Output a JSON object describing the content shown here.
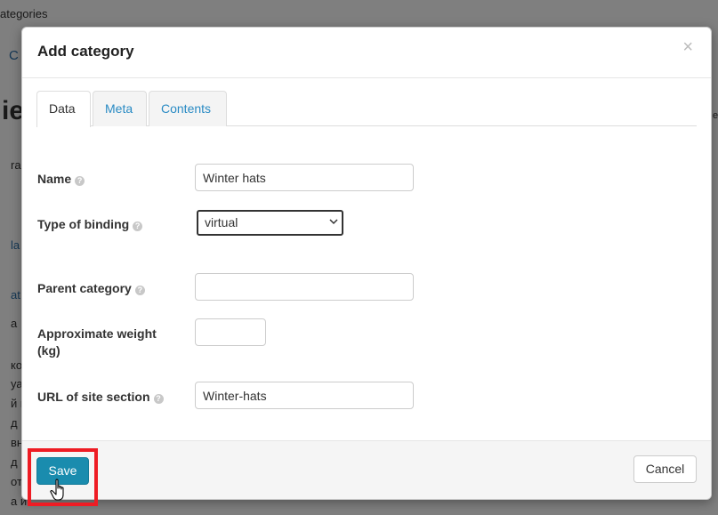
{
  "background": {
    "breadcrumb": "ategories",
    "fragments": {
      "f1": "C",
      "f2": "ie",
      "f3": "ra",
      "f4": "la",
      "f5": "at",
      "f6": "a",
      "f7": "ко",
      "f8": "уа",
      "f9": "й и",
      "f10": "д",
      "f11": "вн",
      "f12": "д",
      "f13": "от",
      "f14": "а и",
      "f15": "e"
    }
  },
  "modal": {
    "title": "Add category",
    "close_symbol": "×",
    "tabs": [
      {
        "label": "Data",
        "active": true
      },
      {
        "label": "Meta",
        "active": false
      },
      {
        "label": "Contents",
        "active": false
      }
    ],
    "help_symbol": "?",
    "fields": {
      "name": {
        "label": "Name",
        "value": "Winter hats"
      },
      "binding_type": {
        "label": "Type of binding",
        "value": "virtual"
      },
      "parent_category": {
        "label": "Parent category",
        "value": ""
      },
      "weight": {
        "label": "Approximate weight (kg)",
        "value": ""
      },
      "url_section": {
        "label": "URL of site section",
        "value": "Winter-hats"
      }
    },
    "footer": {
      "save_label": "Save",
      "cancel_label": "Cancel"
    }
  },
  "colors": {
    "primary_button": "#1a8cae",
    "link": "#2a8bc4",
    "highlight": "#ee1c24"
  },
  "icons": [
    "close-icon",
    "help-icon",
    "chevron-down-icon",
    "hand-pointer-icon"
  ]
}
